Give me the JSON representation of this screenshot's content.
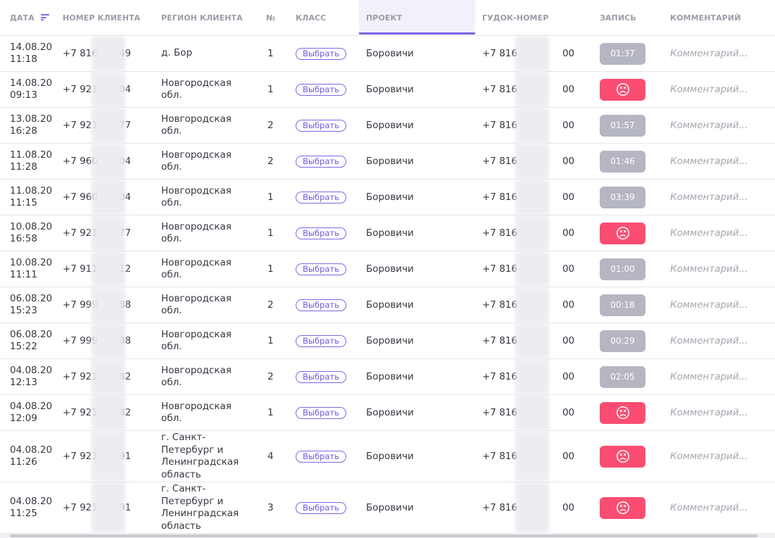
{
  "columns": {
    "date": "ДАТА",
    "client_number": "НОМЕР КЛИЕНТА",
    "client_region": "РЕГИОН КЛИЕНТА",
    "num": "№",
    "class": "КЛАСС",
    "project": "ПРОЕКТ",
    "gudok_number": "ГУДОК-НОМЕР",
    "record": "ЗАПИСЬ",
    "comment": "КОММЕНТАРИЙ"
  },
  "sort": {
    "column": "date",
    "icon": "sort-descending-icon",
    "active_column": "project"
  },
  "colors": {
    "accent": "#7a68e8",
    "record_time": "#b5b6c2",
    "record_missed": "#fa4d71",
    "header_text": "#9b9ca6"
  },
  "rows": [
    {
      "date": "14.08.20",
      "time": "11:18",
      "client_prefix": "+7 816",
      "client_suffix": "49",
      "region_line1": "д. Бор",
      "region_line2": "",
      "region_line3": "",
      "region_line4": "",
      "num": "1",
      "class_label": "Выбрать",
      "project": "Боровичи",
      "gudok_prefix": "+7 816",
      "gudok_suffix": "00",
      "record_type": "time",
      "record": "01:37",
      "comment_placeholder": "Комментарий..."
    },
    {
      "date": "14.08.20",
      "time": "09:13",
      "client_prefix": "+7 921",
      "client_suffix": "04",
      "region_line1": "Новгородская",
      "region_line2": "обл.",
      "region_line3": "",
      "region_line4": "",
      "num": "1",
      "class_label": "Выбрать",
      "project": "Боровичи",
      "gudok_prefix": "+7 816",
      "gudok_suffix": "00",
      "record_type": "missed",
      "record": "",
      "comment_placeholder": "Комментарий..."
    },
    {
      "date": "13.08.20",
      "time": "16:28",
      "client_prefix": "+7 921",
      "client_suffix": "77",
      "region_line1": "Новгородская",
      "region_line2": "обл.",
      "region_line3": "",
      "region_line4": "",
      "num": "2",
      "class_label": "Выбрать",
      "project": "Боровичи",
      "gudok_prefix": "+7 816",
      "gudok_suffix": "00",
      "record_type": "time",
      "record": "01:57",
      "comment_placeholder": "Комментарий..."
    },
    {
      "date": "11.08.20",
      "time": "11:28",
      "client_prefix": "+7 960",
      "client_suffix": "04",
      "region_line1": "Новгородская",
      "region_line2": "обл.",
      "region_line3": "",
      "region_line4": "",
      "num": "2",
      "class_label": "Выбрать",
      "project": "Боровичи",
      "gudok_prefix": "+7 816",
      "gudok_suffix": "00",
      "record_type": "time",
      "record": "01:46",
      "comment_placeholder": "Комментарий..."
    },
    {
      "date": "11.08.20",
      "time": "11:15",
      "client_prefix": "+7 960",
      "client_suffix": "04",
      "region_line1": "Новгородская",
      "region_line2": "обл.",
      "region_line3": "",
      "region_line4": "",
      "num": "1",
      "class_label": "Выбрать",
      "project": "Боровичи",
      "gudok_prefix": "+7 816",
      "gudok_suffix": "00",
      "record_type": "time",
      "record": "03:39",
      "comment_placeholder": "Комментарий..."
    },
    {
      "date": "10.08.20",
      "time": "16:58",
      "client_prefix": "+7 921",
      "client_suffix": "77",
      "region_line1": "Новгородская",
      "region_line2": "обл.",
      "region_line3": "",
      "region_line4": "",
      "num": "1",
      "class_label": "Выбрать",
      "project": "Боровичи",
      "gudok_prefix": "+7 816",
      "gudok_suffix": "00",
      "record_type": "missed",
      "record": "",
      "comment_placeholder": "Комментарий..."
    },
    {
      "date": "10.08.20",
      "time": "11:11",
      "client_prefix": "+7 911",
      "client_suffix": "12",
      "region_line1": "Новгородская",
      "region_line2": "обл.",
      "region_line3": "",
      "region_line4": "",
      "num": "1",
      "class_label": "Выбрать",
      "project": "Боровичи",
      "gudok_prefix": "+7 816",
      "gudok_suffix": "00",
      "record_type": "time",
      "record": "01:00",
      "comment_placeholder": "Комментарий..."
    },
    {
      "date": "06.08.20",
      "time": "15:23",
      "client_prefix": "+7 999",
      "client_suffix": "88",
      "region_line1": "Новгородская",
      "region_line2": "обл.",
      "region_line3": "",
      "region_line4": "",
      "num": "2",
      "class_label": "Выбрать",
      "project": "Боровичи",
      "gudok_prefix": "+7 816",
      "gudok_suffix": "00",
      "record_type": "time",
      "record": "00:18",
      "comment_placeholder": "Комментарий..."
    },
    {
      "date": "06.08.20",
      "time": "15:22",
      "client_prefix": "+7 999",
      "client_suffix": "88",
      "region_line1": "Новгородская",
      "region_line2": "обл.",
      "region_line3": "",
      "region_line4": "",
      "num": "1",
      "class_label": "Выбрать",
      "project": "Боровичи",
      "gudok_prefix": "+7 816",
      "gudok_suffix": "00",
      "record_type": "time",
      "record": "00:29",
      "comment_placeholder": "Комментарий..."
    },
    {
      "date": "04.08.20",
      "time": "12:13",
      "client_prefix": "+7 921",
      "client_suffix": "82",
      "region_line1": "Новгородская",
      "region_line2": "обл.",
      "region_line3": "",
      "region_line4": "",
      "num": "2",
      "class_label": "Выбрать",
      "project": "Боровичи",
      "gudok_prefix": "+7 816",
      "gudok_suffix": "00",
      "record_type": "time",
      "record": "02:05",
      "comment_placeholder": "Комментарий..."
    },
    {
      "date": "04.08.20",
      "time": "12:09",
      "client_prefix": "+7 921",
      "client_suffix": "82",
      "region_line1": "Новгородская",
      "region_line2": "обл.",
      "region_line3": "",
      "region_line4": "",
      "num": "1",
      "class_label": "Выбрать",
      "project": "Боровичи",
      "gudok_prefix": "+7 816",
      "gudok_suffix": "00",
      "record_type": "missed",
      "record": "",
      "comment_placeholder": "Комментарий..."
    },
    {
      "date": "04.08.20",
      "time": "11:26",
      "client_prefix": "+7 921",
      "client_suffix": "91",
      "region_line1": "г. Санкт-",
      "region_line2": "Петербург и",
      "region_line3": "Ленинградская",
      "region_line4": "область",
      "num": "4",
      "class_label": "Выбрать",
      "project": "Боровичи",
      "gudok_prefix": "+7 816",
      "gudok_suffix": "00",
      "record_type": "missed",
      "record": "",
      "comment_placeholder": "Комментарий..."
    },
    {
      "date": "04.08.20",
      "time": "11:25",
      "client_prefix": "+7 921",
      "client_suffix": "91",
      "region_line1": "г. Санкт-",
      "region_line2": "Петербург и",
      "region_line3": "Ленинградская",
      "region_line4": "область",
      "num": "3",
      "class_label": "Выбрать",
      "project": "Боровичи",
      "gudok_prefix": "+7 816",
      "gudok_suffix": "00",
      "record_type": "missed",
      "record": "",
      "comment_placeholder": "Комментарий..."
    }
  ]
}
